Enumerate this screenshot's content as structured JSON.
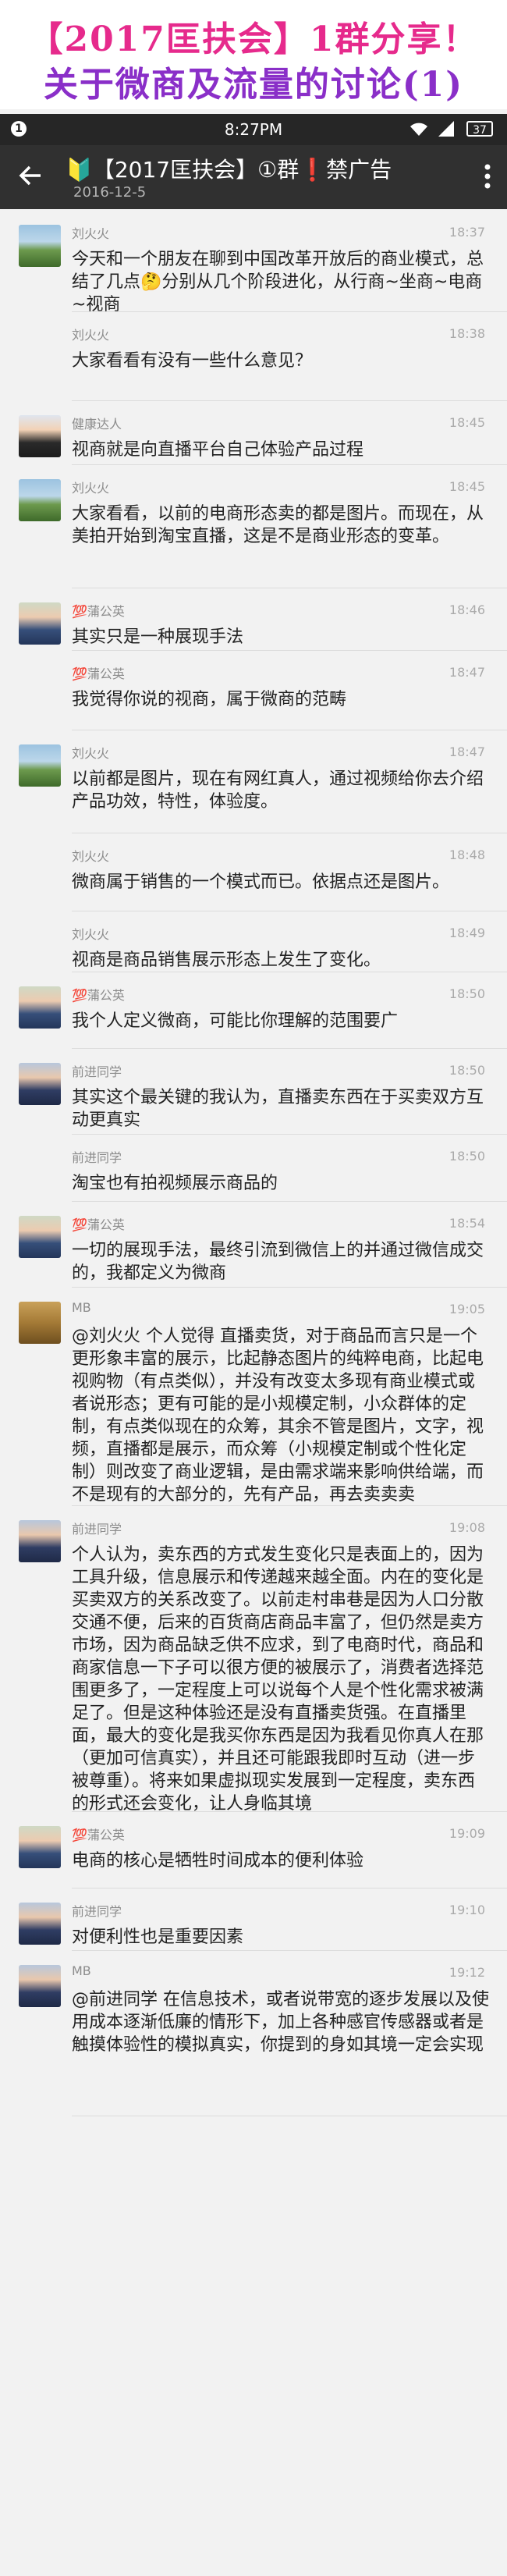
{
  "banner": {
    "line1": "【2017匡扶会】1群分享！",
    "line2": "关于微商及流量的讨论(1)"
  },
  "statusbar": {
    "notification_count": "1",
    "time": "8:27PM",
    "battery": "37"
  },
  "appbar": {
    "title": "🔰【2017匡扶会】①群❗禁广告",
    "date": "2016-12-5"
  },
  "messages": [
    {
      "name": "刘火火",
      "time": "18:37",
      "text": "今天和一个朋友在聊到中国改革开放后的商业模式，总结了几点🤔分别从几个阶段进化，从行商~坐商~电商~视商",
      "avatar": "landscape"
    },
    {
      "name": "刘火火",
      "time": "18:38",
      "text": "大家看看有没有一些什么意见？",
      "avatar": "none"
    },
    {
      "name": "健康达人",
      "time": "18:45",
      "text": "视商就是向直播平台自己体验产品过程",
      "avatar": "person"
    },
    {
      "name": "刘火火",
      "time": "18:45",
      "text": "大家看看，以前的电商形态卖的都是图片。而现在，从美拍开始到淘宝直播，这是不是商业形态的变革。",
      "avatar": "landscape"
    },
    {
      "name": "💯蒲公英",
      "time": "18:46",
      "text": "其实只是一种展现手法",
      "avatar": "person2"
    },
    {
      "name": "💯蒲公英",
      "time": "18:47",
      "text": "我觉得你说的视商，属于微商的范畴",
      "avatar": "none"
    },
    {
      "name": "刘火火",
      "time": "18:47",
      "text": "以前都是图片，现在有网红真人，通过视频给你去介绍产品功效，特性，体验度。",
      "avatar": "landscape"
    },
    {
      "name": "刘火火",
      "time": "18:48",
      "text": "微商属于销售的一个模式而已。依据点还是图片。",
      "avatar": "none"
    },
    {
      "name": "刘火火",
      "time": "18:49",
      "text": "视商是商品销售展示形态上发生了变化。",
      "avatar": "none"
    },
    {
      "name": "💯蒲公英",
      "time": "18:50",
      "text": "我个人定义微商，可能比你理解的范围要广",
      "avatar": "person2"
    },
    {
      "name": "前进同学",
      "time": "18:50",
      "text": "其实这个最关键的我认为，直播卖东西在于买卖双方互动更真实",
      "avatar": "person3"
    },
    {
      "name": "前进同学",
      "time": "18:50",
      "text": "淘宝也有拍视频展示商品的",
      "avatar": "none"
    },
    {
      "name": "💯蒲公英",
      "time": "18:54",
      "text": "一切的展现手法，最终引流到微信上的并通过微信成交的，我都定义为微商",
      "avatar": "person2"
    },
    {
      "name": "MB",
      "time": "19:05",
      "text": "@刘火火 个人觉得 直播卖货，对于商品而言只是一个更形象丰富的展示，比起静态图片的纯粹电商，比起电视购物（有点类似），并没有改变太多现有商业模式或者说形态；更有可能的是小规模定制，小众群体的定制，有点类似现在的众筹，其余不管是图片，文字，视频，直播都是展示，而众筹（小规模定制或个性化定制）则改变了商业逻辑，是由需求端来影响供给端，而不是现有的大部分的，先有产品，再去卖卖卖",
      "avatar": "mb"
    },
    {
      "name": "前进同学",
      "time": "19:08",
      "text": "个人认为，卖东西的方式发生变化只是表面上的，因为工具升级，信息展示和传递越来越全面。内在的变化是买卖双方的关系改变了。以前走村串巷是因为人口分散交通不便，后来的百货商店商品丰富了，但仍然是卖方市场，因为商品缺乏供不应求，到了电商时代，商品和商家信息一下子可以很方便的被展示了，消费者选择范围更多了，一定程度上可以说每个人是个性化需求被满足了。但是这种体验还是没有直播卖货强。在直播里面，最大的变化是我买你东西是因为我看见你真人在那（更加可信真实），并且还可能跟我即时互动（进一步被尊重）。将来如果虚拟现实发展到一定程度，卖东西的形式还会变化，让人身临其境",
      "avatar": "person3"
    },
    {
      "name": "💯蒲公英",
      "time": "19:09",
      "text": "电商的核心是牺牲时间成本的便利体验",
      "avatar": "person2"
    },
    {
      "name": "前进同学",
      "time": "19:10",
      "text": "对便利性也是重要因素",
      "avatar": "person3"
    },
    {
      "name": "MB",
      "time": "19:12",
      "text": "@前进同学 在信息技术，或者说带宽的逐步发展以及使用成本逐渐低廉的情形下，加上各种感官传感器或者是触摸体验性的模拟真实，你提到的身如其境一定会实现",
      "avatar": "person3"
    }
  ]
}
